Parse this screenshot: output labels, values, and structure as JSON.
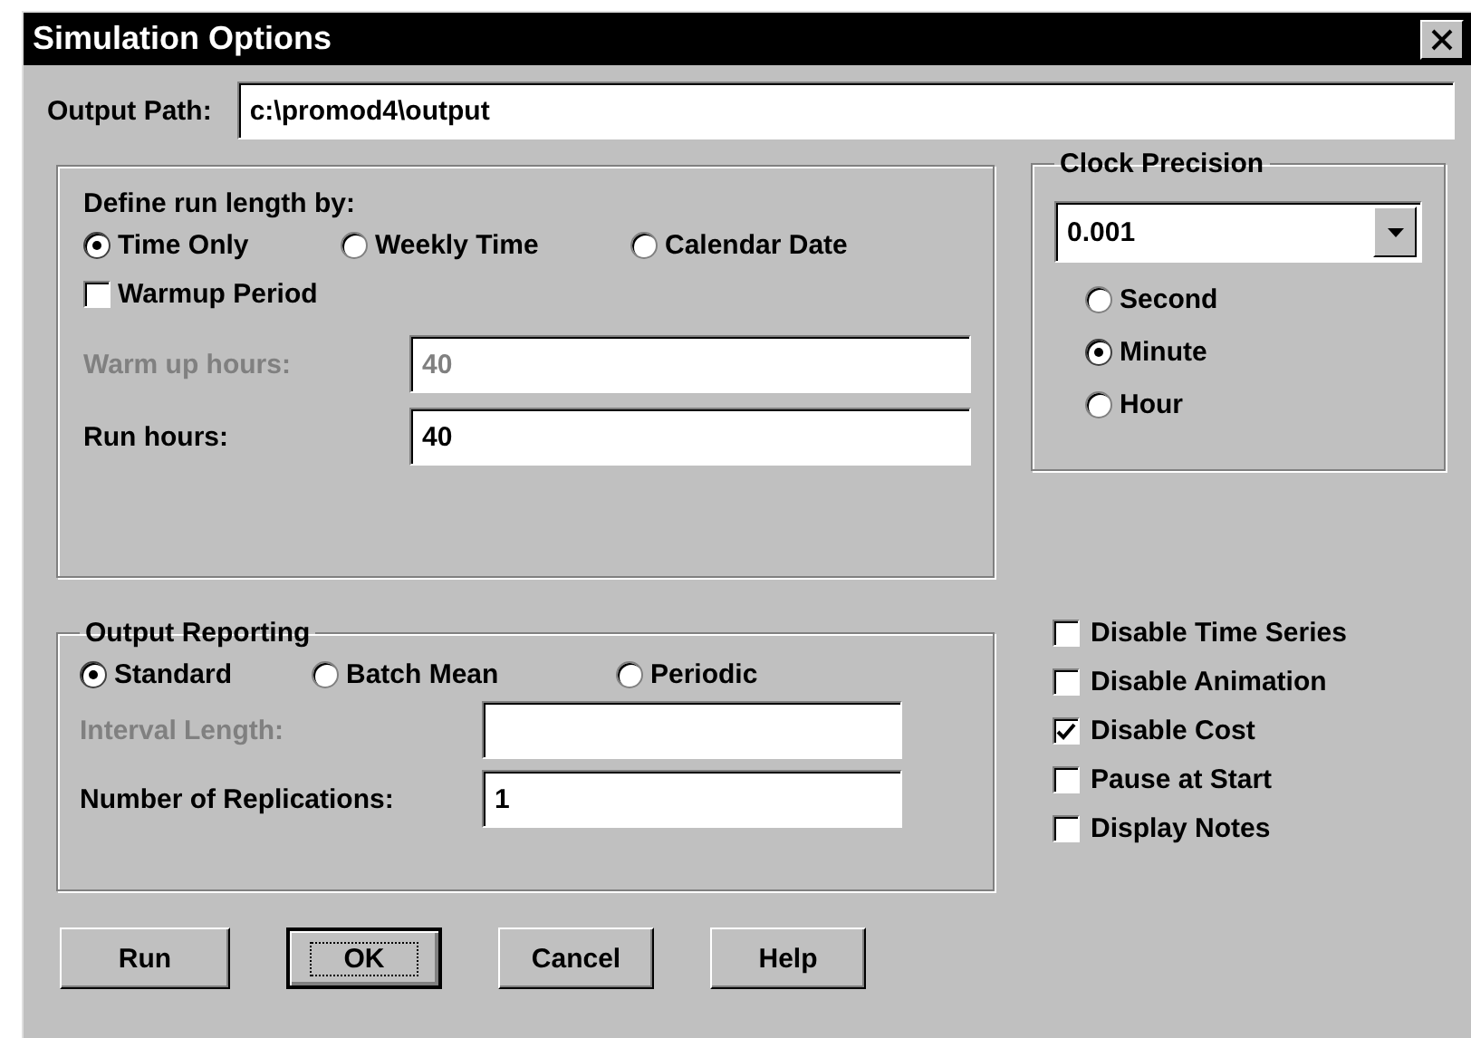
{
  "window": {
    "title": "Simulation Options"
  },
  "output_path": {
    "label": "Output Path:",
    "value": "c:\\promod4\\output"
  },
  "run_length": {
    "heading": "Define run length by:",
    "options": [
      {
        "label": "Time Only",
        "selected": true
      },
      {
        "label": "Weekly Time",
        "selected": false
      },
      {
        "label": "Calendar Date",
        "selected": false
      }
    ],
    "warmup": {
      "label": "Warmup Period",
      "checked": false
    },
    "fields": [
      {
        "label": "Warm up hours:",
        "value": "40",
        "disabled": true
      },
      {
        "label": "Run hours:",
        "value": "40",
        "disabled": false
      }
    ]
  },
  "clock_precision": {
    "title": "Clock Precision",
    "dropdown": {
      "value": "0.001"
    },
    "units": [
      {
        "label": "Second",
        "selected": false
      },
      {
        "label": "Minute",
        "selected": true
      },
      {
        "label": "Hour",
        "selected": false
      }
    ]
  },
  "output_reporting": {
    "title": "Output Reporting",
    "modes": [
      {
        "label": "Standard",
        "selected": true
      },
      {
        "label": "Batch Mean",
        "selected": false
      },
      {
        "label": "Periodic",
        "selected": false
      }
    ],
    "fields": [
      {
        "label": "Interval Length:",
        "disabled": true
      },
      {
        "label": "Number of Replications:",
        "value": "1",
        "disabled": false
      }
    ]
  },
  "options": [
    {
      "label": "Disable Time Series",
      "checked": false
    },
    {
      "label": "Disable Animation",
      "checked": false
    },
    {
      "label": "Disable Cost",
      "checked": true
    },
    {
      "label": "Pause at Start",
      "checked": false
    },
    {
      "label": "Display Notes",
      "checked": false
    }
  ],
  "buttons": [
    {
      "label": "Run",
      "default": false
    },
    {
      "label": "OK",
      "default": true
    },
    {
      "label": "Cancel",
      "default": false
    },
    {
      "label": "Help",
      "default": false
    }
  ]
}
